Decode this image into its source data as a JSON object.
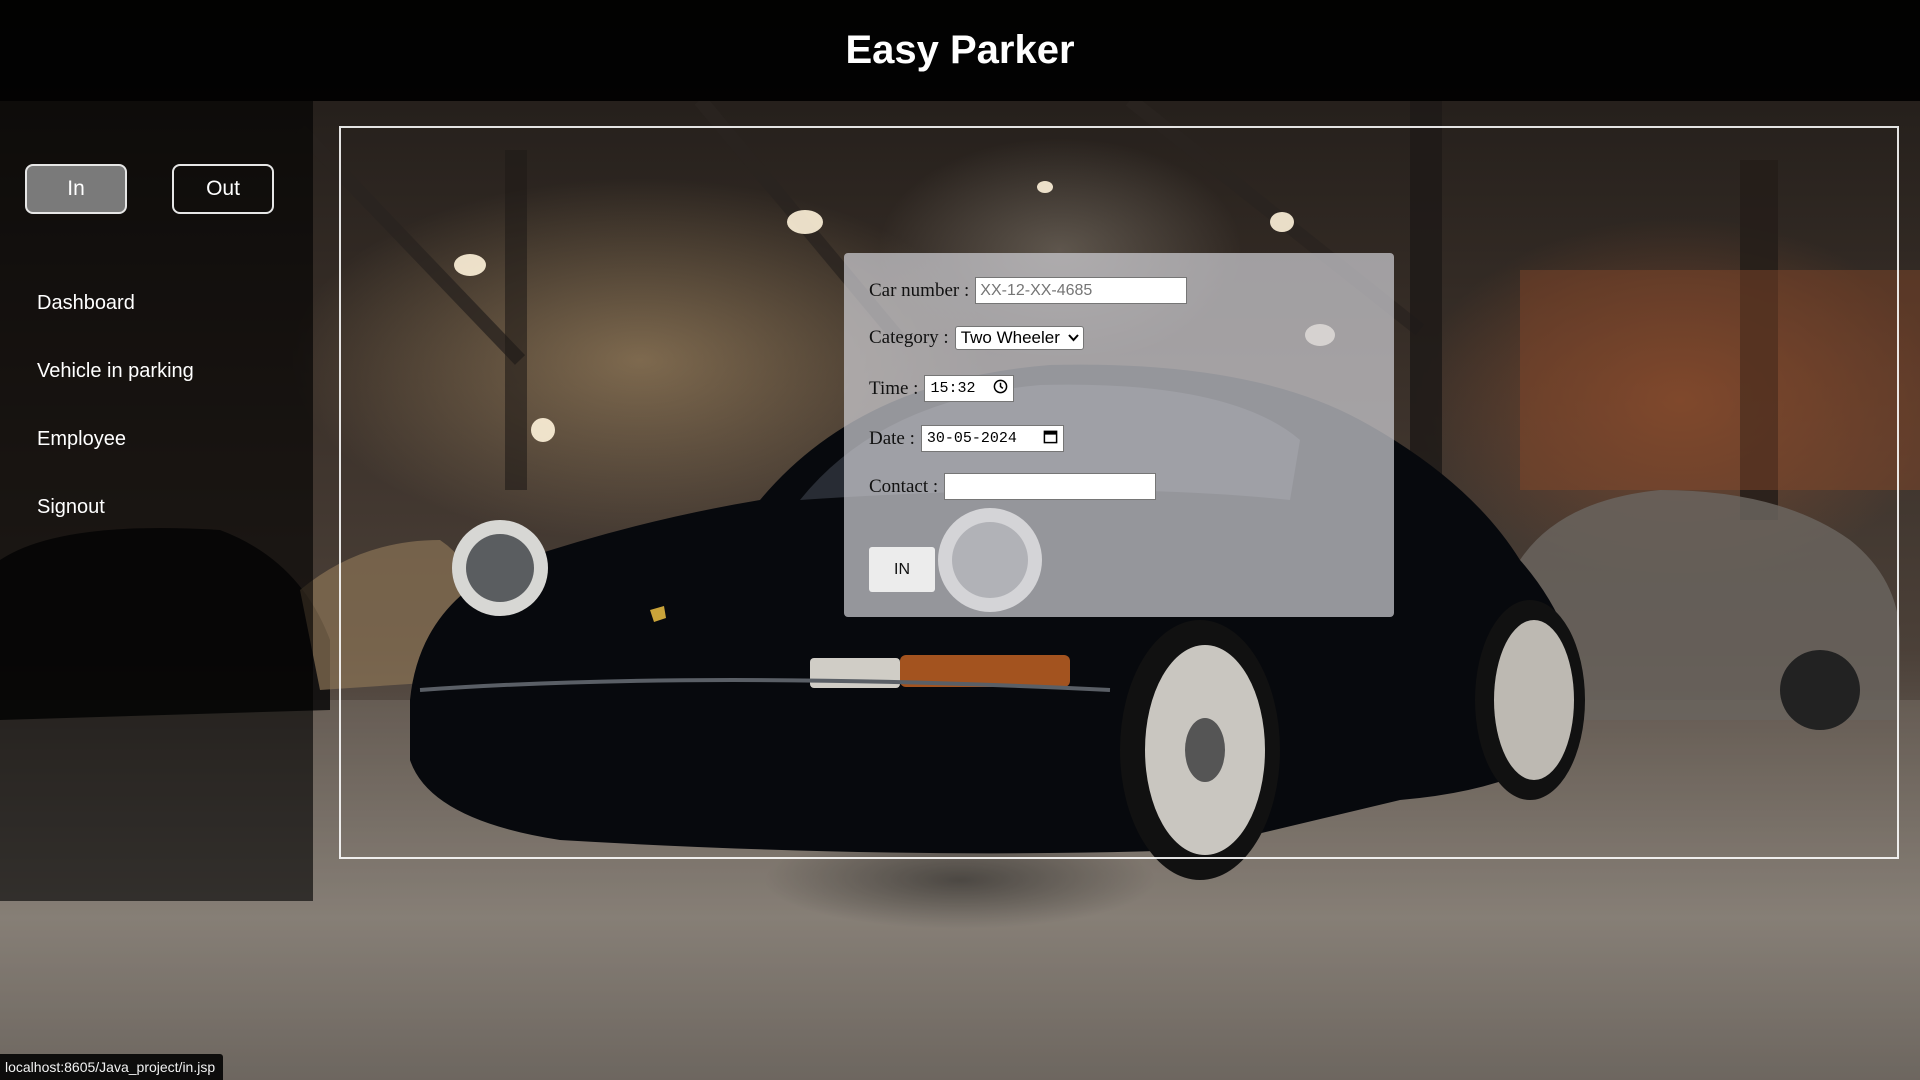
{
  "app": {
    "title": "Easy Parker"
  },
  "sidebar": {
    "toggle_in": "In",
    "toggle_out": "Out",
    "nav": [
      {
        "label": "Dashboard"
      },
      {
        "label": "Vehicle in parking"
      },
      {
        "label": "Employee"
      },
      {
        "label": "Signout"
      }
    ]
  },
  "form": {
    "car_number_label": "Car number :",
    "car_number_placeholder": "XX-12-XX-4685",
    "car_number_value": "",
    "category_label": "Category :",
    "category_value": "Two Wheeler",
    "time_label": "Time :",
    "time_value": "15:32",
    "date_label": "Date :",
    "date_value": "30-05-2024",
    "contact_label": "Contact :",
    "contact_value": "",
    "submit_label": "IN"
  },
  "status_bar": {
    "url": "localhost:8605/Java_project/in.jsp"
  },
  "colors": {
    "header_bg": "#000000",
    "toggle_active_bg": "#7a7a7a",
    "form_card_bg": "#cdcdd2"
  }
}
